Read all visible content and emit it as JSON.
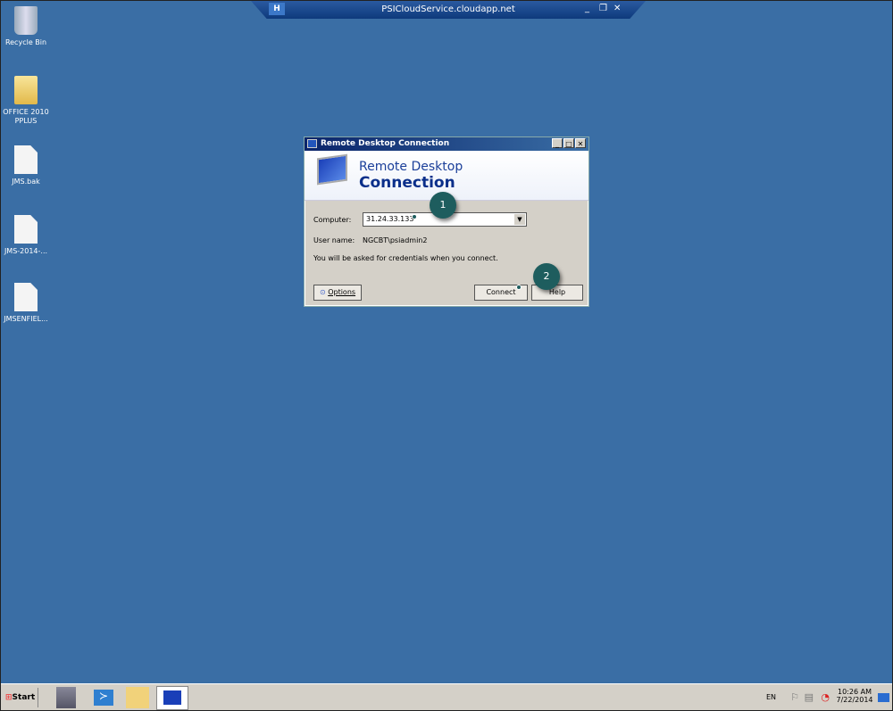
{
  "session_bar": {
    "title": "PSICloudService.cloudapp.net",
    "pin_icon": "pin-icon",
    "min_icon": "minimize-icon",
    "restore_icon": "restore-icon",
    "close_icon": "close-icon"
  },
  "desktop": {
    "icons": [
      {
        "label": "Recycle Bin",
        "icon": "recycle-bin-icon"
      },
      {
        "label": "OFFICE 2010 PPLUS",
        "icon": "folder-icon"
      },
      {
        "label": "JMS.bak",
        "icon": "file-icon"
      },
      {
        "label": "JMS-2014-...",
        "icon": "file-icon"
      },
      {
        "label": "JMSENFIEL...",
        "icon": "file-icon"
      }
    ]
  },
  "dialog": {
    "title": "Remote Desktop Connection",
    "banner_line1": "Remote Desktop",
    "banner_line2": "Connection",
    "computer_label": "Computer:",
    "computer_value": "31.24.33.133",
    "username_label": "User name:",
    "username_value": "NGCBT\\psiadmin2",
    "info": "You will be asked for credentials when you connect.",
    "options": "Options",
    "connect": "Connect",
    "help": "Help"
  },
  "callouts": [
    "1",
    "2"
  ],
  "taskbar": {
    "start": "Start",
    "apps": [
      "server-manager-icon",
      "powershell-icon",
      "explorer-icon",
      "remote-desktop-icon"
    ],
    "lang": "EN",
    "time": "10:26 AM",
    "date": "7/22/2014"
  }
}
